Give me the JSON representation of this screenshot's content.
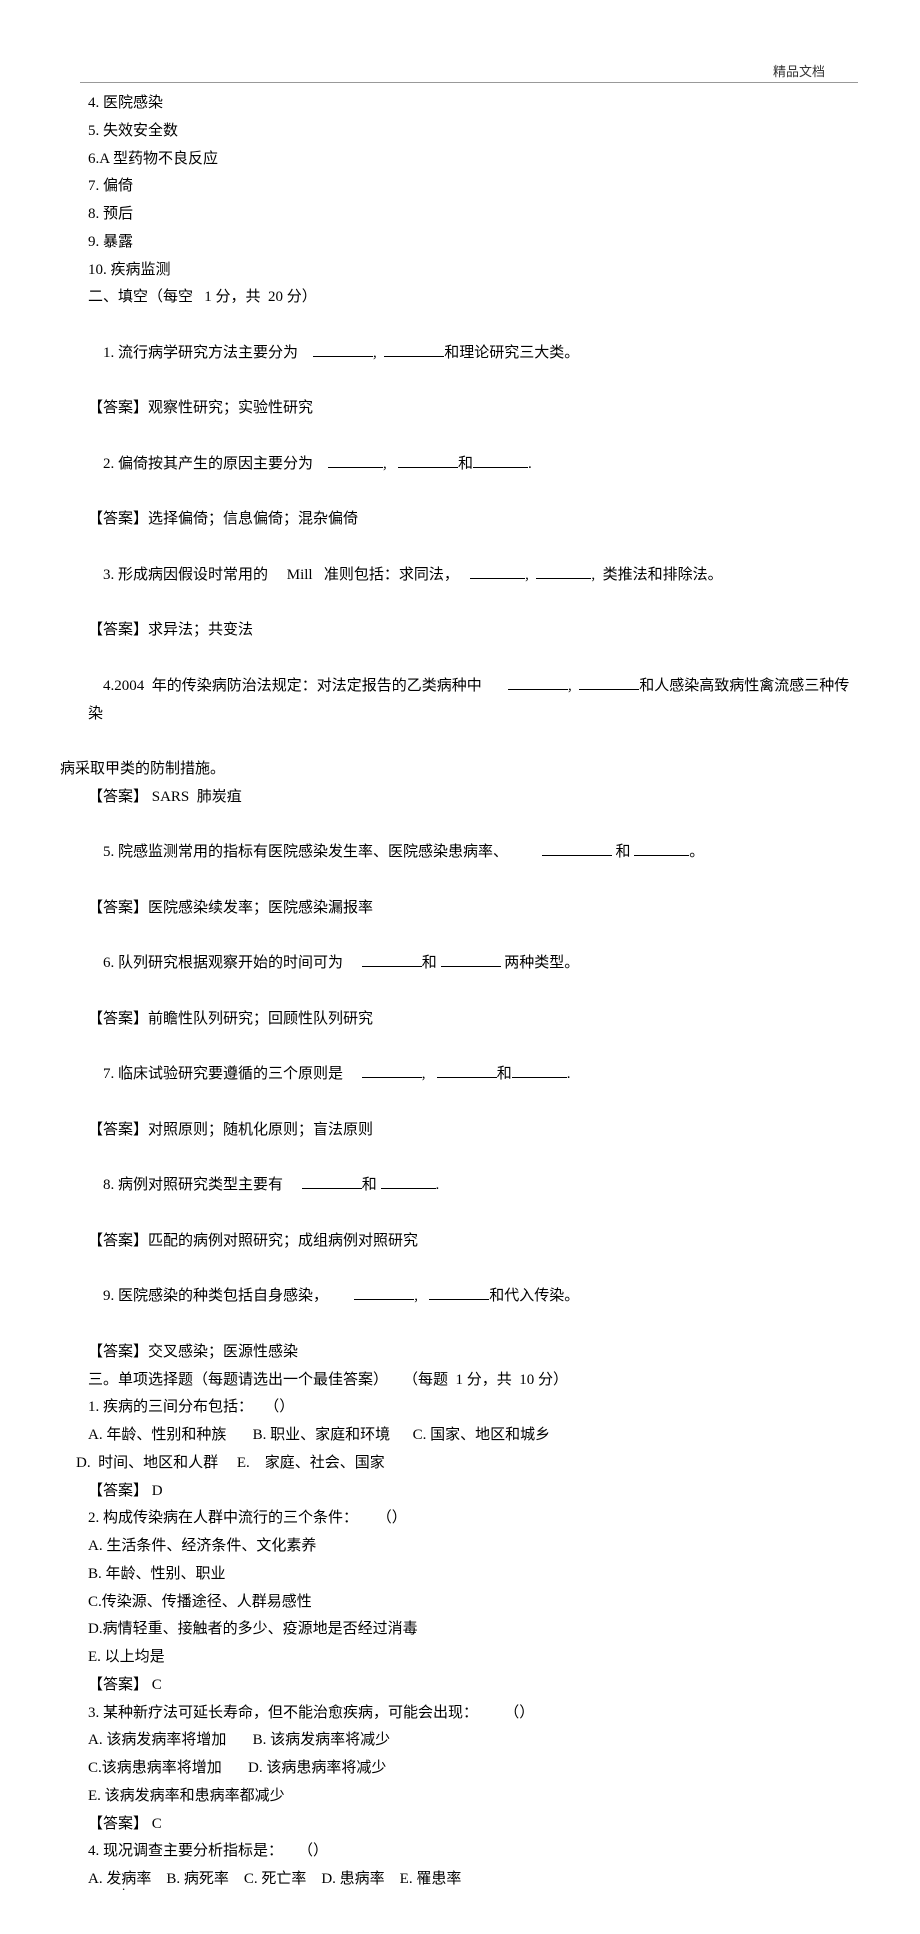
{
  "header": {
    "label": "精品文档"
  },
  "lines": {
    "l1": "4. 医院感染",
    "l2": "5. 失效安全数",
    "l3": "6.A 型药物不良反应",
    "l4": "7. 偏倚",
    "l5": "8. 预后",
    "l6": "9. 暴露",
    "l7": "10. 疾病监测",
    "l8": "二、填空（每空   1 分，共  20 分）",
    "l9a": "1. 流行病学研究方法主要分为    ",
    "l9b": ",  ",
    "l9c": "和理论研究三大类。",
    "l10": "【答案】观察性研究；实验性研究",
    "l11a": "2. 偏倚按其产生的原因主要分为    ",
    "l11b": ",   ",
    "l11c": "和",
    "l11d": ".",
    "l12": "【答案】选择偏倚；信息偏倚；混杂偏倚",
    "l13a": "3. 形成病因假设时常用的     Mill   准则包括：求同法，   ",
    "l13b": ",  ",
    "l13c": ",  类推法和排除法。",
    "l14": "【答案】求异法；共变法",
    "l15a": "4.2004  年的传染病防治法规定：对法定报告的乙类病种中       ",
    "l15b": ",  ",
    "l15c": "和人感染高致病性禽流感三种传染",
    "l15x": "病采取甲类的防制措施。",
    "l16": "【答案】 SARS  肺炭疽",
    "l17a": "5. 院感监测常用的指标有医院感染发生率、医院感染患病率、         ",
    "l17b": " 和 ",
    "l17c": "。",
    "l18": "【答案】医院感染续发率；医院感染漏报率",
    "l19a": "6. 队列研究根据观察开始的时间可为     ",
    "l19b": "和 ",
    "l19c": " 两种类型。",
    "l20": "【答案】前瞻性队列研究；回顾性队列研究",
    "l21a": "7. 临床试验研究要遵循的三个原则是     ",
    "l21b": ",   ",
    "l21c": "和",
    "l21d": ".",
    "l22": "【答案】对照原则；随机化原则；盲法原则",
    "l23a": "8. 病例对照研究类型主要有     ",
    "l23b": "和 ",
    "l23c": ".",
    "l24": "【答案】匹配的病例对照研究；成组病例对照研究",
    "l25a": "9. 医院感染的种类包括自身感染，       ",
    "l25b": ",   ",
    "l25c": "和代入传染。",
    "l26": "【答案】交叉感染；医源性感染",
    "l27": "三。单项选择题（每题请选出一个最佳答案）    （每题  1 分，共  10 分）",
    "l28": "1. 疾病的三间分布包括：   （）",
    "l29": "A. 年龄、性别和种族       B. 职业、家庭和环境      C. 国家、地区和城乡",
    "l30": "D.  时间、地区和人群     E.    家庭、社会、国家",
    "l31": "【答案】 D",
    "l32": "2. 构成传染病在人群中流行的三个条件：     （）",
    "l33": "A. 生活条件、经济条件、文化素养",
    "l34": "B. 年龄、性别、职业",
    "l35": "C.传染源、传播途径、人群易感性",
    "l36": "D.病情轻重、接触者的多少、疫源地是否经过消毒",
    "l37": "E. 以上均是",
    "l38": "【答案】 C",
    "l39": "3. 某种新疗法可延长寿命，但不能治愈疾病，可能会出现：       （）",
    "l40": "A. 该病发病率将增加       B. 该病发病率将减少",
    "l41": "C.该病患病率将增加       D. 该病患病率将减少",
    "l42": "E. 该病发病率和患病率都减少",
    "l43": "【答案】 C",
    "l44": "4. 现况调查主要分析指标是：    （）",
    "l45": "A. 发病率    B. 病死率    C. 死亡率    D. 患病率    E. 罹患率"
  },
  "footer": {
    "dot": "."
  }
}
